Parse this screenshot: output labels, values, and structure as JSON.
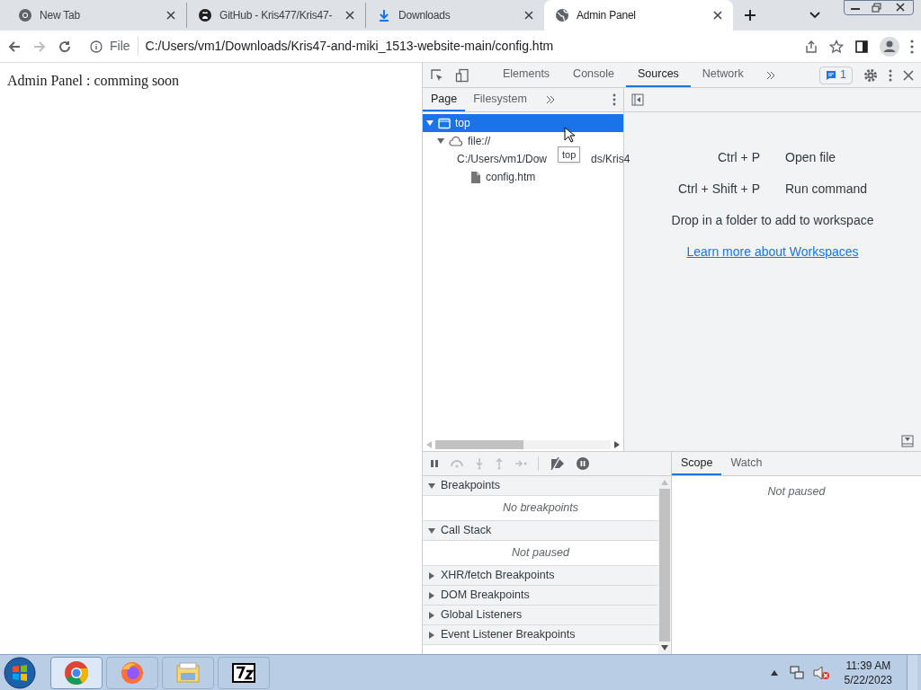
{
  "tabs": [
    {
      "title": "New Tab",
      "kind": "chrome",
      "selected": false
    },
    {
      "title": "GitHub - Kris477/Kris47-",
      "kind": "github",
      "selected": false
    },
    {
      "title": "Downloads",
      "kind": "download",
      "selected": false
    },
    {
      "title": "Admin Panel",
      "kind": "globe",
      "selected": true
    }
  ],
  "address": {
    "scheme": "File",
    "url": "C:/Users/vm1/Downloads/Kris47-and-miki_1513-website-main/config.htm"
  },
  "page": {
    "text": "Admin Panel : comming soon"
  },
  "devtools": {
    "tabs": [
      {
        "label": "Elements",
        "selected": false
      },
      {
        "label": "Console",
        "selected": false
      },
      {
        "label": "Sources",
        "selected": true
      },
      {
        "label": "Network",
        "selected": false
      }
    ],
    "issues": "1",
    "navigator_tabs": [
      {
        "label": "Page",
        "selected": true
      },
      {
        "label": "Filesystem",
        "selected": false
      }
    ],
    "tree": [
      {
        "kind": "frame",
        "label_parts": [
          "top"
        ],
        "selected": true,
        "expanded": true,
        "children": [
          {
            "kind": "cloud",
            "label_parts": [
              "file://"
            ],
            "selected": false,
            "expanded": true,
            "children": [
              {
                "kind": "folder",
                "label_parts": [
                  "C:/Users/vm1/Dow",
                  "ds/Kris4"
                ],
                "selected": false,
                "expanded": true,
                "children": [
                  {
                    "kind": "file",
                    "label_parts": [
                      "config.htm"
                    ],
                    "selected": false
                  }
                ]
              }
            ]
          }
        ]
      }
    ],
    "tooltip": "top",
    "shortcuts": [
      {
        "keys": "Ctrl + P",
        "action": "Open file"
      },
      {
        "keys": "Ctrl + Shift + P",
        "action": "Run command"
      }
    ],
    "drop_hint": "Drop in a folder to add to workspace",
    "link": "Learn more about Workspaces",
    "sections": [
      {
        "title": "Breakpoints",
        "expanded": true,
        "message": "No breakpoints"
      },
      {
        "title": "Call Stack",
        "expanded": true,
        "message": "Not paused"
      },
      {
        "title": "XHR/fetch Breakpoints",
        "expanded": false
      },
      {
        "title": "DOM Breakpoints",
        "expanded": false
      },
      {
        "title": "Global Listeners",
        "expanded": false
      },
      {
        "title": "Event Listener Breakpoints",
        "expanded": false
      }
    ],
    "scope_tabs": [
      {
        "label": "Scope",
        "selected": true
      },
      {
        "label": "Watch",
        "selected": false
      }
    ],
    "scope_message": "Not paused"
  },
  "taskbar": {
    "apps": [
      {
        "kind": "chrome",
        "selected": true
      },
      {
        "kind": "firefox",
        "selected": false
      },
      {
        "kind": "explorer",
        "selected": false
      },
      {
        "kind": "archiver",
        "selected": false
      }
    ],
    "time": "11:39 AM",
    "date": "5/22/2023"
  }
}
